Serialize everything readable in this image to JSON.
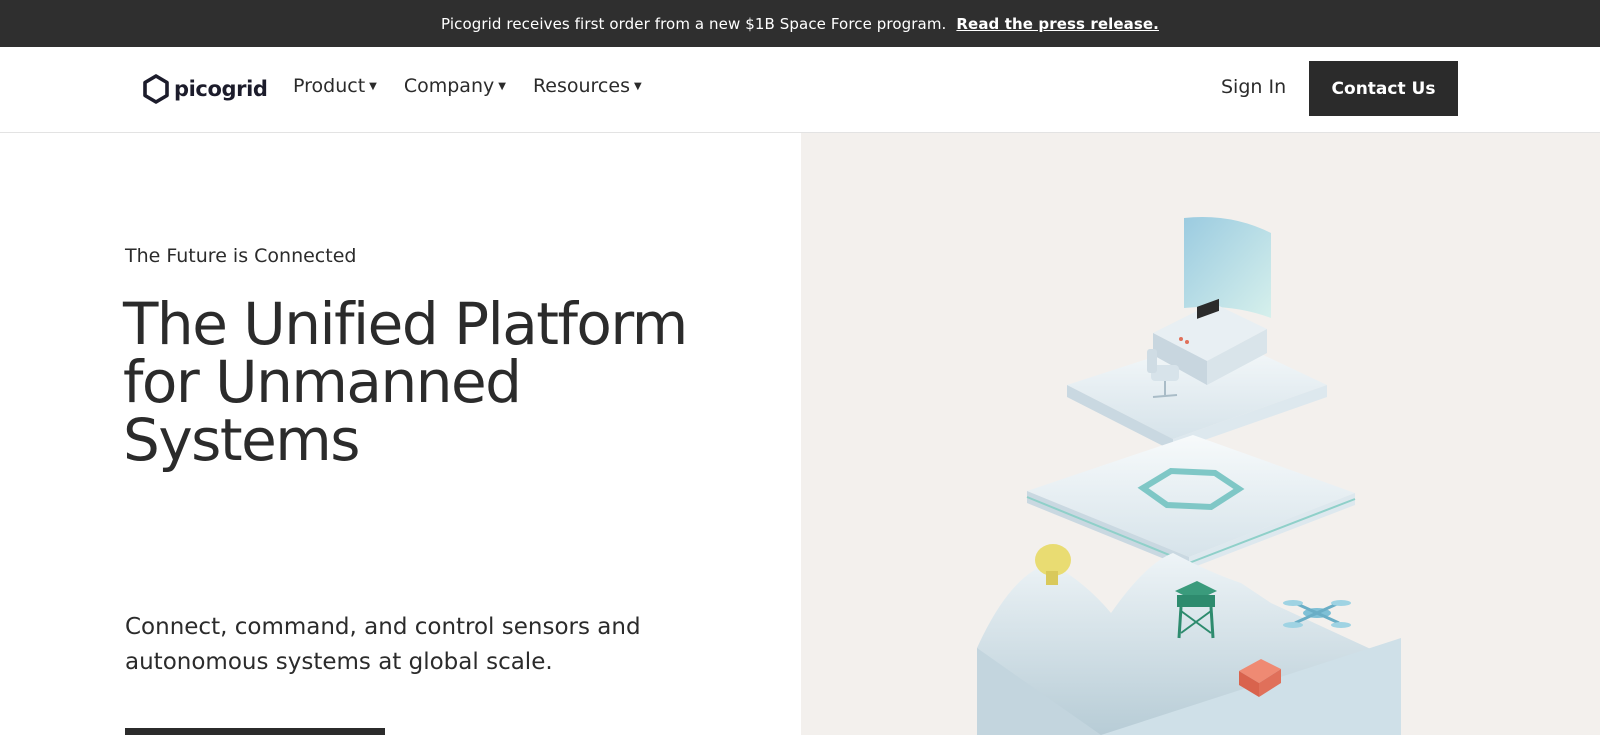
{
  "announcement": {
    "message": "Picogrid receives first order from a new $1B Space Force program.",
    "link_text": "Read the press release."
  },
  "header": {
    "logo_text": "picogrid",
    "logo_icon": "hexagon-logo-icon",
    "nav": [
      {
        "label": "Product",
        "icon": "caret-down-icon"
      },
      {
        "label": "Company",
        "icon": "caret-down-icon"
      },
      {
        "label": "Resources",
        "icon": "caret-down-icon"
      }
    ],
    "sign_in": "Sign In",
    "contact": "Contact Us"
  },
  "hero": {
    "kicker": "The Future is Connected",
    "headline_lines": [
      "The Unified Platform",
      "for Unmanned",
      "Systems"
    ],
    "lede_lines": [
      "Connect, command, and control sensors and",
      "autonomous systems at global scale."
    ],
    "illustration": "isometric-platform-illustration"
  },
  "colors": {
    "dark": "#2b2b2b",
    "announce_bg": "#2f2f2f",
    "illustration_bg": "#f3f0ed",
    "accent_teal": "#7fc7c6",
    "accent_green": "#2e8b6e",
    "accent_red": "#e0705a",
    "accent_yellow": "#e9dc72"
  }
}
